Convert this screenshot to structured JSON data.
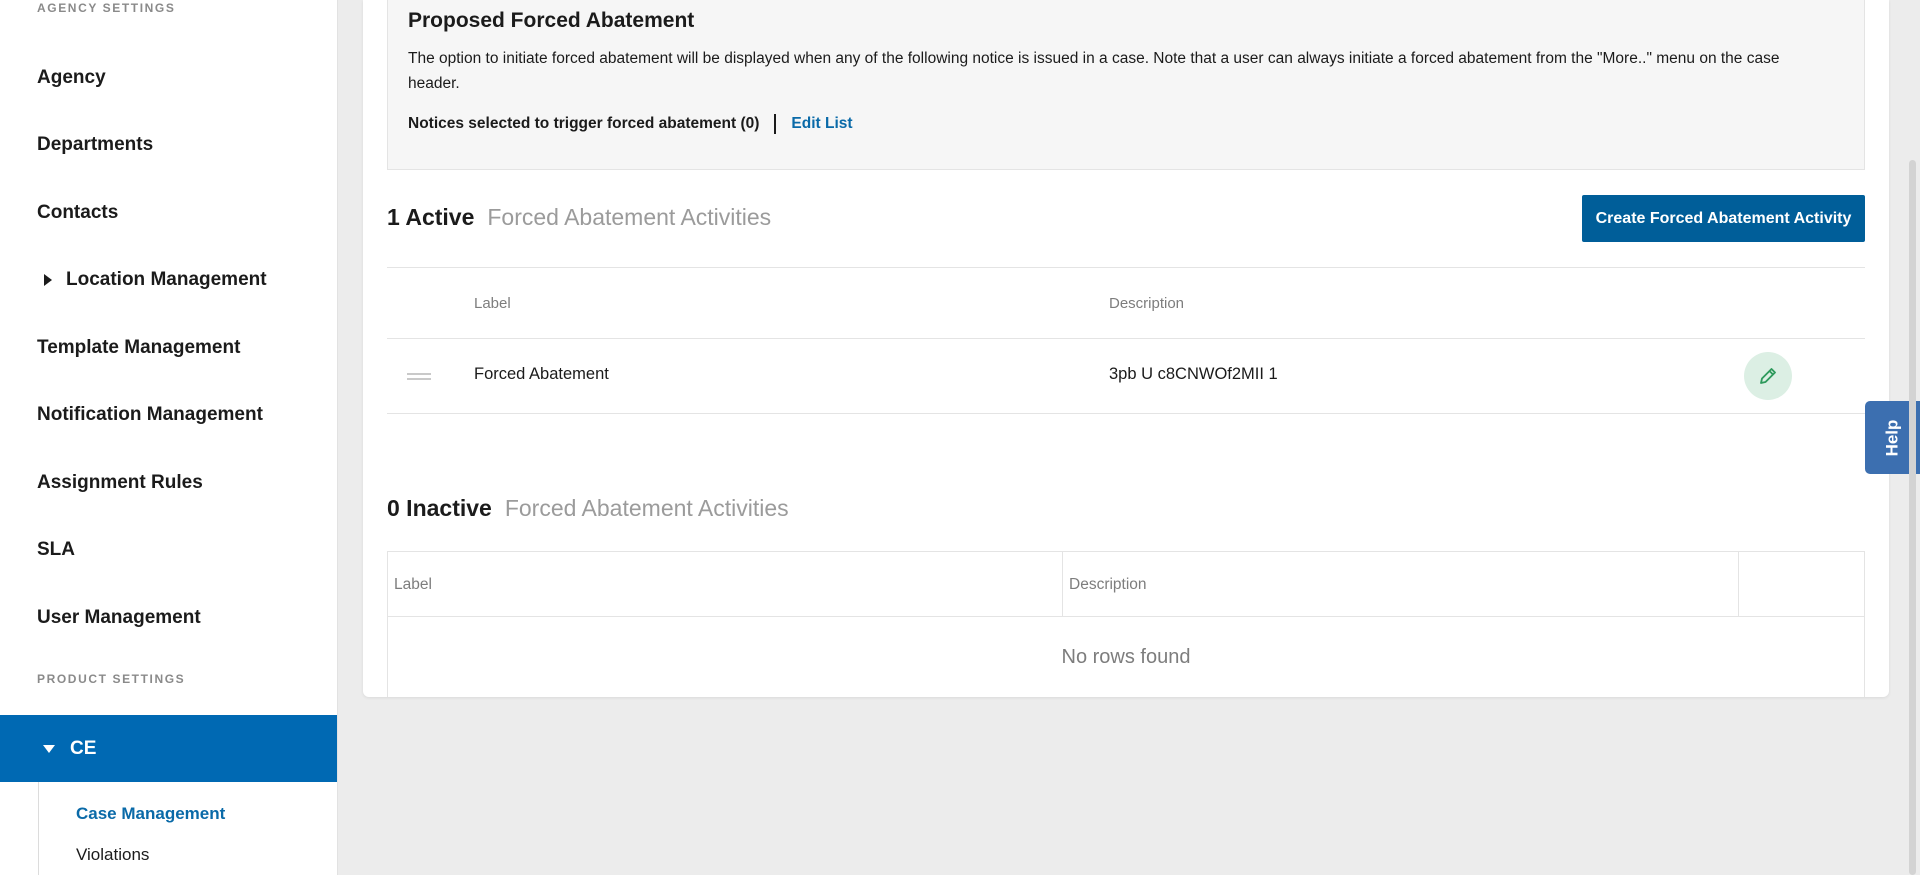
{
  "sidebar": {
    "agency_section": "AGENCY SETTINGS",
    "items": [
      {
        "label": "Agency"
      },
      {
        "label": "Departments"
      },
      {
        "label": "Contacts"
      },
      {
        "label": "Location Management"
      },
      {
        "label": "Template Management"
      },
      {
        "label": "Notification Management"
      },
      {
        "label": "Assignment Rules"
      },
      {
        "label": "SLA"
      },
      {
        "label": "User Management"
      }
    ],
    "product_section": "PRODUCT SETTINGS",
    "active_item": "CE",
    "sub_items": [
      {
        "label": "Case Management",
        "selected": true
      },
      {
        "label": "Violations",
        "selected": false
      }
    ],
    "colors": {
      "active_bg": "#0069b3",
      "selected_sub": "#0a6aa8"
    }
  },
  "notice": {
    "title": "Proposed Forced Abatement",
    "description": "The option to initiate forced abatement will be displayed when any of the following notice is issued in a case. Note that a user can always initiate a forced abatement from the \"More..\" menu on the case header.",
    "selected_label": "Notices selected to trigger forced abatement (0)",
    "edit_link": "Edit List"
  },
  "active_section": {
    "count": "1 Active",
    "label": "Forced Abatement Activities",
    "create_button": "Create Forced Abatement Activity",
    "columns": {
      "label": "Label",
      "description": "Description"
    },
    "rows": [
      {
        "label": "Forced Abatement",
        "description": "3pb U c8CNWOf2MII 1"
      }
    ]
  },
  "inactive_section": {
    "count": "0 Inactive",
    "label": "Forced Abatement Activities",
    "columns": {
      "label": "Label",
      "description": "Description"
    },
    "empty_text": "No rows found"
  },
  "help": {
    "label": "Help"
  },
  "icons": {
    "drag": "drag-handle-icon",
    "edit": "pencil-icon",
    "expand": "caret-right-icon",
    "collapse": "caret-down-icon"
  }
}
